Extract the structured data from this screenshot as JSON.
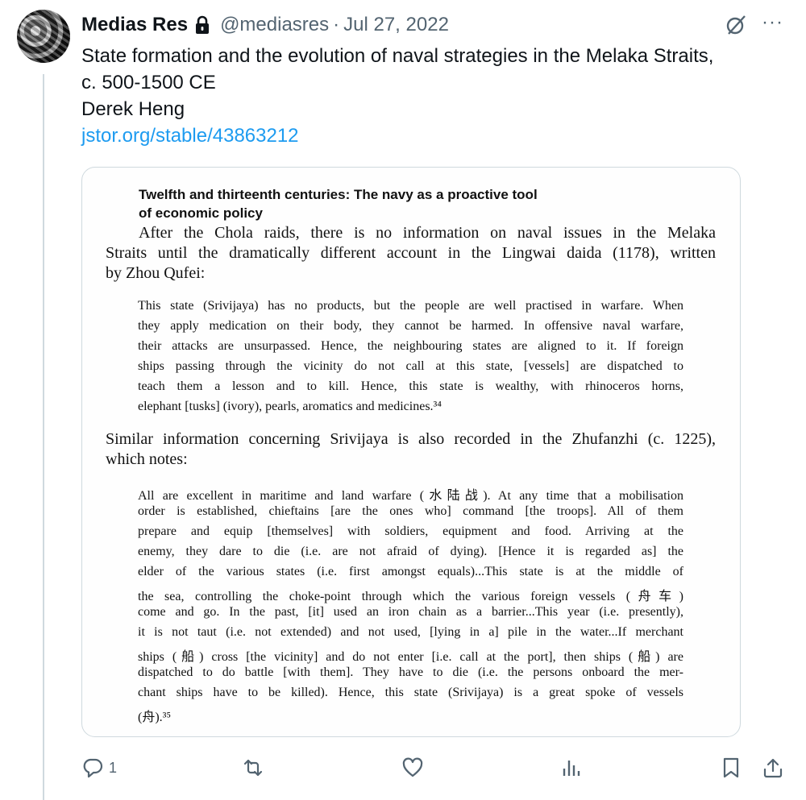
{
  "tweet": {
    "author_name": "Medias Res",
    "handle": "@mediasres",
    "separator": "·",
    "date": "Jul 27, 2022",
    "more_glyph": "···",
    "text_lines": [
      "State formation and the evolution of naval strategies in the Melaka Straits,",
      "c. 500-1500 CE",
      "Derek Heng"
    ],
    "link": "jstor.org/stable/43863212"
  },
  "document": {
    "heading_lines": [
      "Twelfth and thirteenth centuries: The navy as a proactive tool",
      "of economic policy"
    ],
    "para1_lines": [
      "After the Chola raids, there is no information on naval issues in the Melaka",
      "Straits until the dramatically different account in the Lingwai daida (1178), written",
      "by Zhou Qufei:"
    ],
    "quote1_lines": [
      "This state (Srivijaya) has no products, but the people are well practised in warfare. When",
      "they apply medication on their body, they cannot be harmed. In offensive naval warfare,",
      "their attacks are unsurpassed. Hence, the neighbouring states are aligned to it. If foreign",
      "ships passing through the vicinity do not call at this state, [vessels] are dispatched to",
      "teach them a lesson and to kill. Hence, this state is wealthy, with rhinoceros horns,",
      "elephant [tusks] (ivory), pearls, aromatics and medicines.³⁴"
    ],
    "para2_lines": [
      "Similar information concerning Srivijaya is also recorded in the Zhufanzhi (c. 1225),",
      "which notes:"
    ],
    "quote2_lines": [
      "All are excellent in maritime and land warfare (水陆战). At any time that a mobilisation",
      "order is established, chieftains [are the ones who] command [the troops]. All of them",
      "prepare and equip [themselves] with soldiers, equipment and food. Arriving at the",
      "enemy, they dare to die (i.e. are not afraid of dying). [Hence it is regarded as] the",
      "elder of the various states (i.e. first amongst equals)...This state is at the middle of",
      "the sea, controlling the choke-point through which the various foreign vessels (舟车)",
      "come and go. In the past, [it] used an iron chain as a barrier...This year (i.e. presently),",
      "it is not taut (i.e. not extended) and not used, [lying in a] pile in the water...If merchant",
      "ships (船) cross [the vicinity] and do not enter [i.e. call at the port], then ships (船) are",
      "dispatched to do battle [with them]. They have to die (i.e. the persons onboard the mer-",
      "chant ships have to be killed). Hence, this state (Srivijaya) is a great spoke of vessels",
      "(舟).³⁵"
    ]
  },
  "actions": {
    "reply_count": "1",
    "icons": [
      "reply-icon",
      "retweet-icon",
      "like-icon",
      "views-icon",
      "bookmark-icon",
      "share-icon"
    ],
    "icon_color": "#536471"
  },
  "colors": {
    "link": "#1d9bf0",
    "muted": "#536471",
    "border": "#cfd9de"
  }
}
